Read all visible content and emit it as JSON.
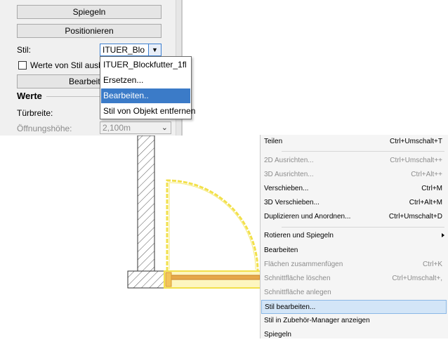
{
  "properties_panel": {
    "mirror_button": "Spiegeln",
    "position_button": "Positionieren",
    "style_label": "Stil:",
    "style_value": "ITUER_Blo",
    "values_checkbox_label": "Werte von Stil ausb",
    "edit_button": "Bearbeiten",
    "values_section": "Werte",
    "door_width_label": "Türbreite:",
    "opening_height_label": "Öffnungshöhe:",
    "opening_height_value": "2,100m"
  },
  "style_dropdown": {
    "items": [
      {
        "label": "ITUER_Blockfutter_1fl",
        "selected": false
      },
      {
        "label": "Ersetzen...",
        "selected": false
      },
      {
        "label": "Bearbeiten..",
        "selected": true
      },
      {
        "label": "Stil von Objekt entfernen",
        "selected": false
      }
    ]
  },
  "context_menu": {
    "items": [
      {
        "label": "Teilen",
        "shortcut": "Ctrl+Umschalt+T",
        "disabled": false
      },
      {
        "label": "2D Ausrichten...",
        "shortcut": "Ctrl+Umschalt++",
        "disabled": true
      },
      {
        "label": "3D Ausrichten...",
        "shortcut": "Ctrl+Alt++",
        "disabled": true
      },
      {
        "label": "Verschieben...",
        "shortcut": "Ctrl+M",
        "disabled": false
      },
      {
        "label": "3D Verschieben...",
        "shortcut": "Ctrl+Alt+M",
        "disabled": false
      },
      {
        "label": "Duplizieren und Anordnen...",
        "shortcut": "Ctrl+Umschalt+D",
        "disabled": false
      },
      {
        "label": "Rotieren und Spiegeln",
        "shortcut": "",
        "disabled": false
      },
      {
        "label": "Bearbeiten",
        "shortcut": "",
        "disabled": false
      },
      {
        "label": "Flächen zusammenfügen",
        "shortcut": "Ctrl+K",
        "disabled": true
      },
      {
        "label": "Schnittfläche löschen",
        "shortcut": "Ctrl+Umschalt+,",
        "disabled": true
      },
      {
        "label": "Schnittfläche anlegen",
        "shortcut": "",
        "disabled": true
      },
      {
        "label": "Stil bearbeiten...",
        "shortcut": "",
        "disabled": false
      },
      {
        "label": "Stil in Zubehör-Manager anzeigen",
        "shortcut": "",
        "disabled": false
      },
      {
        "label": "Spiegeln",
        "shortcut": "",
        "disabled": false
      }
    ]
  },
  "colors": {
    "selection_yellow": "#f2e04a",
    "hatch": "#555555",
    "menu_highlight": "#d3e5f7",
    "dropdown_selected": "#3b7bc8"
  }
}
